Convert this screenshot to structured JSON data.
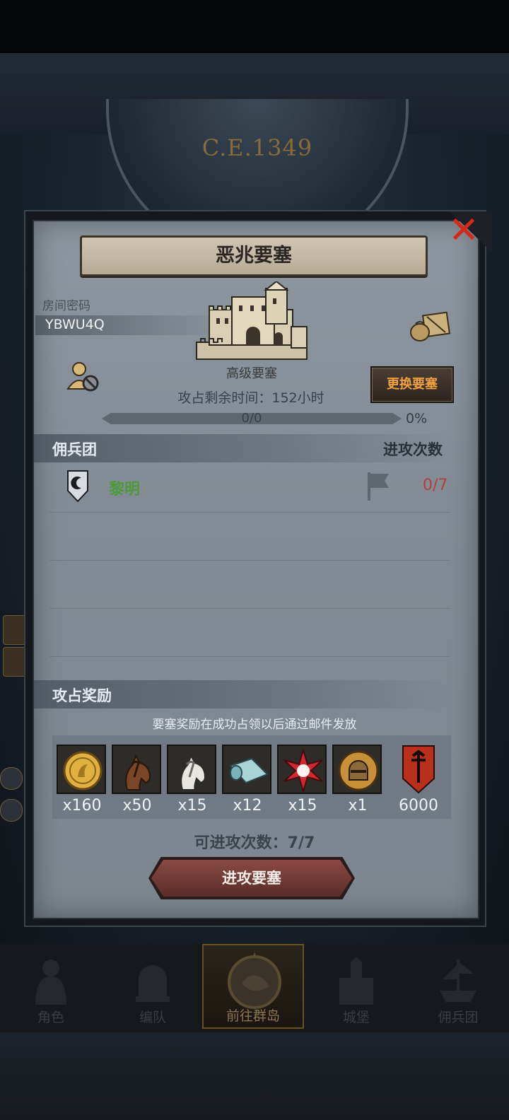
{
  "background": {
    "era": "C.E.1349"
  },
  "panel": {
    "title": "恶兆要塞",
    "room_label": "房间密码",
    "room_code": "YBWU4Q",
    "fortress_name": "高级要塞",
    "change_button": "更换要塞",
    "time_remaining": "攻占剩余时间：152小时",
    "progress": {
      "text": "0/0",
      "percent_label": "0%",
      "value": 0
    },
    "mercenary_header": "佣兵团",
    "attack_header": "进攻次数",
    "mercenaries": [
      {
        "name": "黎明",
        "count": "0/7"
      }
    ],
    "rewards_header": "攻占奖励",
    "reward_note": "要塞奖励在成功占领以后通过邮件发放",
    "rewards": [
      {
        "icon": "gold-coin-icon",
        "qty": "x160"
      },
      {
        "icon": "brown-horse-icon",
        "qty": "x50"
      },
      {
        "icon": "white-horse-icon",
        "qty": "x15"
      },
      {
        "icon": "cloth-roll-icon",
        "qty": "x12"
      },
      {
        "icon": "red-star-gem-icon",
        "qty": "x15"
      },
      {
        "icon": "knight-helmet-coin-icon",
        "qty": "x1"
      },
      {
        "icon": "guild-banner-icon",
        "qty": "6000"
      }
    ],
    "attack_count": "可进攻次数：7/7",
    "attack_button": "进攻要塞"
  },
  "nav": {
    "items": [
      {
        "label": "角色",
        "icon": "knight-icon"
      },
      {
        "label": "编队",
        "icon": "helmet-icon"
      },
      {
        "label": "前往群岛",
        "icon": "compass-icon"
      },
      {
        "label": "城堡",
        "icon": "castle-icon"
      },
      {
        "label": "佣兵团",
        "icon": "ship-icon"
      }
    ],
    "active": "前往群岛"
  },
  "colors": {
    "panel_bg": "#868f97",
    "accent_orange": "#f0a040",
    "merc_green": "#4c9a3a",
    "count_red": "#b04040",
    "close_red": "#d42a1c"
  }
}
